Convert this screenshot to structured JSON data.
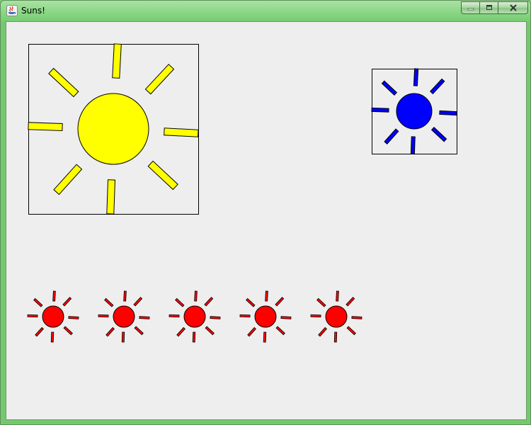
{
  "window": {
    "title": "Suns!",
    "controls": {
      "minimize_icon": "minimize-icon",
      "maximize_icon": "maximize-icon",
      "close_icon": "close-icon"
    }
  },
  "colors": {
    "background": "#eeeeee",
    "outline": "#000000",
    "sun_large": "#ffff00",
    "sun_medium": "#0000ff",
    "sun_small": "#ff0000"
  },
  "suns": [
    {
      "id": "large-yellow-sun",
      "color": "#ffff00",
      "framed": true,
      "size": "large"
    },
    {
      "id": "medium-blue-sun",
      "color": "#0000ff",
      "framed": true,
      "size": "medium"
    },
    {
      "id": "small-red-sun-1",
      "color": "#ff0000",
      "framed": false,
      "size": "small"
    },
    {
      "id": "small-red-sun-2",
      "color": "#ff0000",
      "framed": false,
      "size": "small"
    },
    {
      "id": "small-red-sun-3",
      "color": "#ff0000",
      "framed": false,
      "size": "small"
    },
    {
      "id": "small-red-sun-4",
      "color": "#ff0000",
      "framed": false,
      "size": "small"
    },
    {
      "id": "small-red-sun-5",
      "color": "#ff0000",
      "framed": false,
      "size": "small"
    }
  ]
}
